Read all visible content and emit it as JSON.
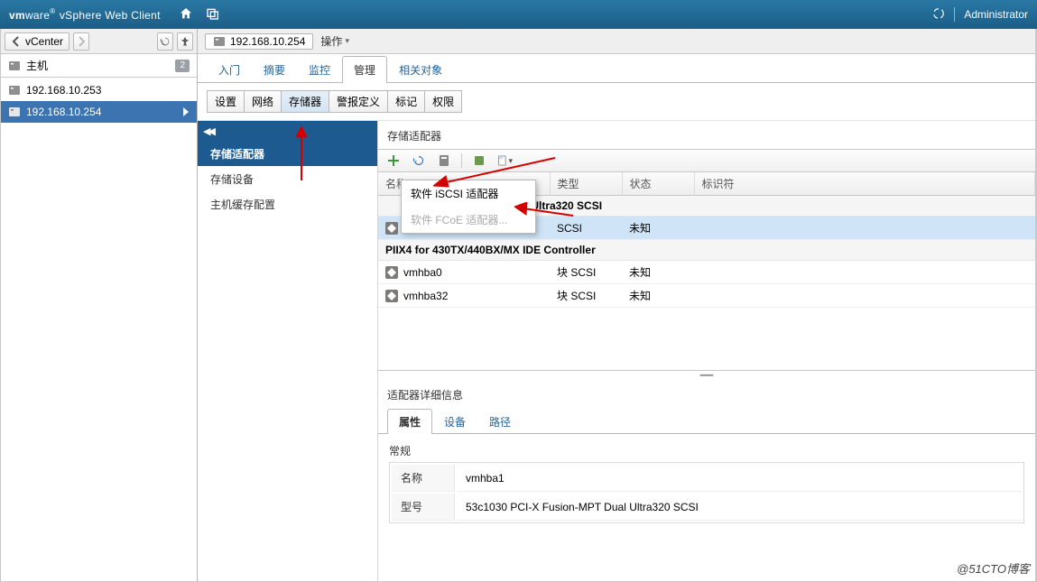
{
  "brand": {
    "prefix": "vm",
    "mid": "ware",
    "suffix": "vSphere Web Client"
  },
  "topRight": {
    "user": "Administrator"
  },
  "nav": {
    "back_label": "vCenter",
    "section": "主机",
    "badge": "2",
    "hosts": [
      {
        "label": "192.168.10.253",
        "selected": false
      },
      {
        "label": "192.168.10.254",
        "selected": true
      }
    ]
  },
  "crumb": {
    "host": "192.168.10.254",
    "action": "操作"
  },
  "tabs": [
    "入门",
    "摘要",
    "监控",
    "管理",
    "相关对象"
  ],
  "tabs_active": 3,
  "subtabs": [
    "设置",
    "网络",
    "存储器",
    "警报定义",
    "标记",
    "权限"
  ],
  "subtabs_active": 2,
  "side2": {
    "items": [
      "存储适配器",
      "存储设备",
      "主机缓存配置"
    ],
    "active": 0
  },
  "panel": {
    "title": "存储适配器",
    "columns": [
      "名称",
      "类型",
      "状态",
      "标识符"
    ],
    "popup": {
      "opt1": "软件 iSCSI 适配器",
      "opt2": "软件 FCoE 适配器..."
    },
    "groups": [
      {
        "label": "Dual Ultra320 SCSI",
        "rows": [
          {
            "name": "vmhba1",
            "type": "SCSI",
            "status": "未知",
            "id": ""
          }
        ],
        "sel": 0
      },
      {
        "label": "PIIX4 for 430TX/440BX/MX IDE Controller",
        "rows": [
          {
            "name": "vmhba0",
            "type": "块 SCSI",
            "status": "未知",
            "id": ""
          },
          {
            "name": "vmhba32",
            "type": "块 SCSI",
            "status": "未知",
            "id": ""
          }
        ]
      }
    ]
  },
  "detail": {
    "title": "适配器详细信息",
    "tabs": [
      "属性",
      "设备",
      "路径"
    ],
    "tabs_active": 0,
    "section": "常规",
    "rows": {
      "name_label": "名称",
      "name_val": "vmhba1",
      "model_label": "型号",
      "model_val": "53c1030 PCI-X Fusion-MPT Dual Ultra320 SCSI"
    }
  },
  "watermark": "@51CTO博客"
}
